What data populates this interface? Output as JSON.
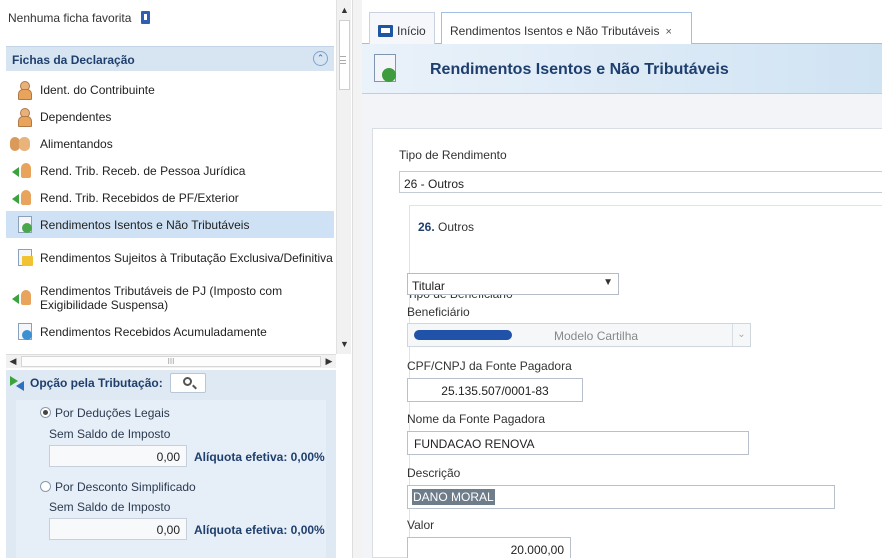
{
  "sidebar": {
    "favorites_text": "Nenhuma ficha favorita",
    "section_title": "Fichas da Declaração",
    "collapse_icon": "double-chevron-up",
    "items": [
      {
        "label": "Ident. do Contribuinte",
        "icon": "person-icon"
      },
      {
        "label": "Dependentes",
        "icon": "person-icon"
      },
      {
        "label": "Alimentandos",
        "icon": "people-icon"
      },
      {
        "label": "Rend. Trib. Receb. de Pessoa Jurídica",
        "icon": "arrow-person-icon"
      },
      {
        "label": "Rend. Trib. Recebidos de PF/Exterior",
        "icon": "arrow-person-icon"
      },
      {
        "label": "Rendimentos Isentos e Não Tributáveis",
        "icon": "document-check-icon",
        "selected": true
      },
      {
        "label": "Rendimentos Sujeitos à Tributação Exclusiva/Definitiva",
        "icon": "document-warning-icon"
      },
      {
        "label": "Rendimentos Tributáveis de PJ (Imposto com Exigibilidade Suspensa)",
        "icon": "arrow-document-warning-icon"
      },
      {
        "label": "Rendimentos Recebidos Acumuladamente",
        "icon": "document-arrow-icon"
      }
    ]
  },
  "tributacao": {
    "title": "Opção pela Tributação:",
    "options": [
      {
        "label": "Por Deduções Legais",
        "selected": true,
        "saldo_label": "Sem Saldo de Imposto",
        "saldo_value": "0,00",
        "aliquota": "Alíquota efetiva: 0,00%"
      },
      {
        "label": "Por Desconto Simplificado",
        "selected": false,
        "saldo_label": "Sem Saldo de Imposto",
        "saldo_value": "0,00",
        "aliquota": "Alíquota efetiva: 0,00%"
      }
    ]
  },
  "tabs": [
    {
      "label": "Início",
      "active": false
    },
    {
      "label": "Rendimentos Isentos e Não Tributáveis",
      "active": true,
      "close": "×"
    }
  ],
  "header": {
    "title": "Rendimentos Isentos e Não Tributáveis"
  },
  "form": {
    "tipo_rendimento_label": "Tipo de Rendimento",
    "tipo_rendimento_value": "26 - Outros",
    "section_number": "26.",
    "section_name": "Outros",
    "tipo_beneficiario_label": "Tipo de Beneficiário",
    "tipo_beneficiario_value": "Titular",
    "beneficiario_label": "Beneficiário",
    "beneficiario_value": "Modelo Cartilha",
    "cnpj_label": "CPF/CNPJ da Fonte Pagadora",
    "cnpj_value": "25.135.507/0001-83",
    "nome_fonte_label": "Nome da Fonte Pagadora",
    "nome_fonte_value": "FUNDACAO RENOVA",
    "descricao_label": "Descrição",
    "descricao_value": "DANO MORAL",
    "valor_label": "Valor",
    "valor_value": "20.000,00"
  },
  "colors": {
    "accent": "#1f3f6d",
    "selected_row": "#cfe2f5",
    "panel": "#dfe9f4"
  }
}
